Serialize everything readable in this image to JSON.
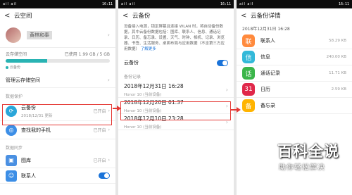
{
  "status": {
    "carrier": "ail ail",
    "time": "16:11"
  },
  "panel1": {
    "back": "<",
    "title": "云空间",
    "profile_name": "黄林和奉",
    "storage_label": "云存储空间",
    "storage_used": "已使用 1.99 GB / 5 GB",
    "storage_fraction": 0.4,
    "legend": "云备份",
    "manage": "管理云存储空间",
    "section_protect": "数据保护",
    "backup": {
      "title": "云备份",
      "sub": "2018/12/31 更新",
      "status": "已开启"
    },
    "findphone": {
      "title": "查找我的手机",
      "status": "已开启"
    },
    "section_sync": "数据同步",
    "gallery": {
      "title": "图库",
      "status": "已开启"
    },
    "contacts": {
      "title": "联系人"
    }
  },
  "panel2": {
    "back": "<",
    "title": "云备份",
    "desc": "设备接入电源，锁定屏幕且连接 WLAN 时，将自动备份数据，其中云备份数据包括：图库、联系人、信息、通话记录、日历、备忘录、设置、天气、时钟、相机、记录、浏览器、书签、生活服务、桌面布局与应用数据（不含第三方应用数据）",
    "more": "了解更多",
    "toggle_label": "云备份",
    "records_label": "备份记录",
    "records": [
      {
        "date": "2018年12月31日 16:28",
        "device": "Honor 10 (当前设备)"
      },
      {
        "date": "2018年12月20日 01:37",
        "device": "Honor 10 (当前设备)"
      },
      {
        "date": "2018年12月10日 23:28",
        "device": "Honor 10 (当前设备)"
      }
    ]
  },
  "panel3": {
    "back": "<",
    "title": "云备份详情",
    "date": "2018年12月31日 16:28",
    "items": [
      {
        "name": "联系人",
        "size": "58.29 KB",
        "color": "#ff8a3d",
        "icon": "联"
      },
      {
        "name": "信息",
        "size": "240.00 KB",
        "color": "#34b9d9",
        "icon": "信"
      },
      {
        "name": "通话记录",
        "size": "11.71 KB",
        "color": "#3bb54a",
        "icon": "话"
      },
      {
        "name": "日历",
        "size": "2.59 KB",
        "color": "#e0284a",
        "icon": "31"
      },
      {
        "name": "备忘录",
        "size": "",
        "color": "#ffb400",
        "icon": "备"
      }
    ]
  },
  "watermark": {
    "title": "百科全说",
    "subtitle": "助你轻松解决"
  }
}
